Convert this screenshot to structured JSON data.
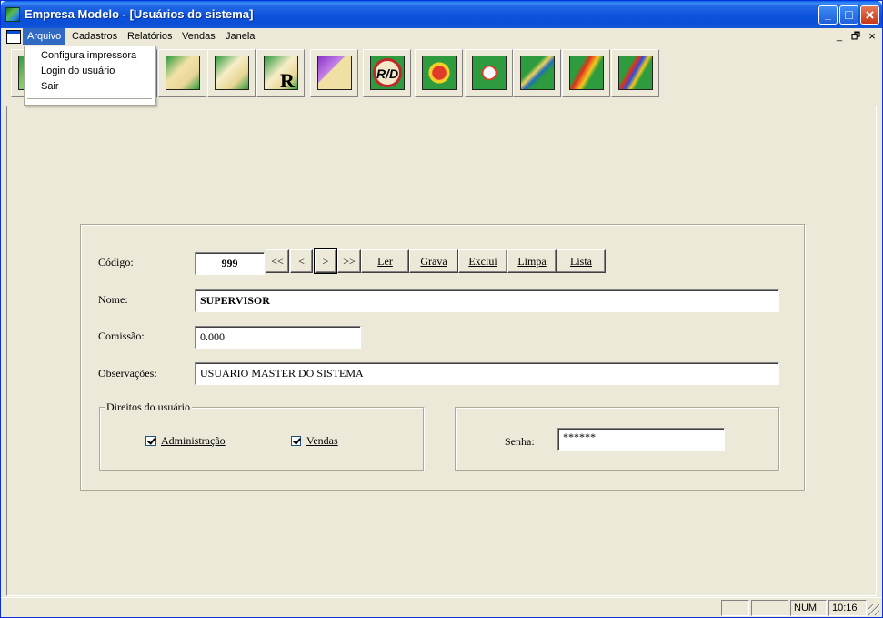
{
  "window": {
    "title": "Empresa Modelo - [Usuários do sistema]",
    "buttons": {
      "minimize": "_",
      "maximize": "□",
      "close": "×"
    }
  },
  "menubar": {
    "items": [
      {
        "label": "Arquivo",
        "active": true
      },
      {
        "label": "Cadastros"
      },
      {
        "label": "Relatórios"
      },
      {
        "label": "Vendas"
      },
      {
        "label": "Janela"
      }
    ],
    "mdi_controls": {
      "minimize": "_",
      "restore": "🗗",
      "close": "×"
    }
  },
  "dropdown": {
    "items": [
      "Configura impressora",
      "Login do usuário",
      "Sair"
    ]
  },
  "toolbar": {
    "tools": [
      {
        "icon": "users-icon",
        "symbol": ""
      },
      {
        "icon": "folder-icon",
        "symbol": ""
      },
      {
        "icon": "folder-stack-icon",
        "symbol": ""
      },
      {
        "icon": "document-edit-icon",
        "symbol": ""
      },
      {
        "icon": "document-pen-icon",
        "symbol": ""
      },
      {
        "icon": "report-icon",
        "symbol": "R"
      },
      {
        "icon": "calendar-grid-icon",
        "symbol": ""
      },
      {
        "icon": "rd-icon",
        "symbol": "R/D"
      },
      {
        "icon": "refresh-icon",
        "symbol": ""
      },
      {
        "icon": "home-icon",
        "symbol": ""
      },
      {
        "icon": "pen-tool-icon",
        "symbol": ""
      },
      {
        "icon": "sort-down-icon",
        "symbol": ""
      },
      {
        "icon": "sort-down-alt-icon",
        "symbol": ""
      }
    ]
  },
  "form": {
    "codigo_label": "Código:",
    "codigo_value": "999",
    "nav": {
      "first": "<<",
      "prev": "<",
      "next": ">",
      "last": ">>"
    },
    "actions": {
      "ler": "Ler",
      "grava": "Grava",
      "exclui": "Exclui",
      "limpa": "Limpa",
      "lista": "Lista"
    },
    "nome_label": "Nome:",
    "nome_value": "SUPERVISOR",
    "comissao_label": "Comissão:",
    "comissao_value": "0.000",
    "obs_label": "Observações:",
    "obs_value": "USUARIO MASTER DO SISTEMA",
    "direitos": {
      "title": "Direitos do usuário",
      "administracao": "Administração",
      "vendas": "Vendas"
    },
    "senha_label": "Senha:",
    "senha_value": "******"
  },
  "statusbar": {
    "num": "NUM",
    "time": "10:16"
  }
}
